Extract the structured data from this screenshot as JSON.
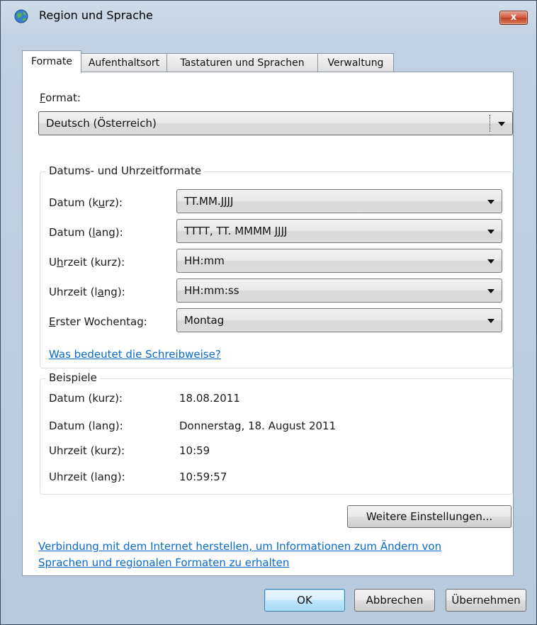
{
  "window": {
    "title": "Region und Sprache",
    "close_label": "x"
  },
  "tabs": [
    {
      "label": "Formate"
    },
    {
      "label": "Aufenthaltsort"
    },
    {
      "label": "Tastaturen und Sprachen"
    },
    {
      "label": "Verwaltung"
    }
  ],
  "format": {
    "label_prefix": "F",
    "label_rest": "ormat:",
    "value": "Deutsch (Österreich)"
  },
  "datetime_group": {
    "title": "Datums- und Uhrzeitformate",
    "rows": [
      {
        "label": "Datum (kurz):",
        "value": "TT.MM.JJJJ"
      },
      {
        "label": "Datum (lang):",
        "value": "TTTT, TT. MMMM JJJJ"
      },
      {
        "label": "Uhrzeit (kurz):",
        "value": "HH:mm"
      },
      {
        "label": "Uhrzeit (lang):",
        "value": "HH:mm:ss"
      },
      {
        "label": "Erster Wochentag:",
        "value": "Montag"
      }
    ],
    "help_link": "Was bedeutet die Schreibweise?"
  },
  "examples_group": {
    "title": "Beispiele",
    "rows": [
      {
        "label": "Datum (kurz):",
        "value": "18.08.2011"
      },
      {
        "label": "Datum (lang):",
        "value": "Donnerstag, 18. August 2011"
      },
      {
        "label": "Uhrzeit (kurz):",
        "value": "10:59"
      },
      {
        "label": "Uhrzeit (lang):",
        "value": "10:59:57"
      }
    ]
  },
  "more_settings_button": "Weitere Einstellungen...",
  "internet_link_line1": "Verbindung mit dem Internet herstellen, um Informationen zum Ändern von",
  "internet_link_line2": "Sprachen und regionalen Formaten zu erhalten",
  "buttons": {
    "ok": "OK",
    "cancel": "Abbrechen",
    "apply": "Übernehmen"
  }
}
